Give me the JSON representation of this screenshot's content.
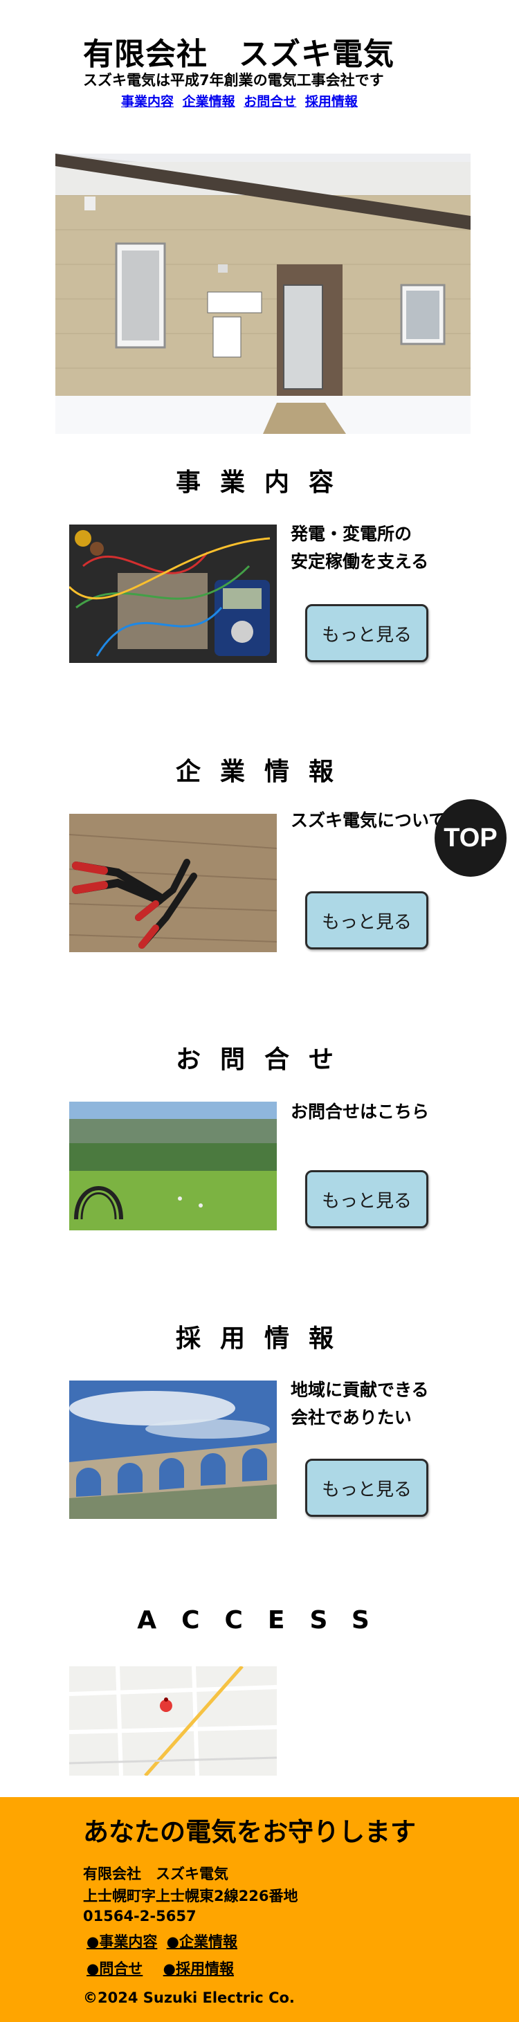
{
  "header": {
    "title": "有限会社　スズキ電気",
    "tagline": "スズキ電気は平成7年創業の電気工事会社です",
    "nav": [
      "事業内容",
      "企業情報",
      "お問合せ",
      "採用情報"
    ]
  },
  "sections": [
    {
      "title": "事業内容",
      "blurb": "発電・変電所の\n安定稼働を支える",
      "button": "もっと見る",
      "image_icon": "electronics-tester-photo"
    },
    {
      "title": "企業情報",
      "blurb": "スズキ電気について",
      "button": "もっと見る",
      "image_icon": "pliers-on-wood-photo"
    },
    {
      "title": "お問合せ",
      "blurb": "お問合せはこちら",
      "button": "もっと見る",
      "image_icon": "meadow-arch-photo"
    },
    {
      "title": "採用情報",
      "blurb": "地域に貢献できる\n会社でありたい",
      "button": "もっと見る",
      "image_icon": "arch-bridge-photo"
    }
  ],
  "access": {
    "title": "ACCESS"
  },
  "top_button": "TOP",
  "footer": {
    "slogan": "あなたの電気をお守りします",
    "company": "有限会社　スズキ電気",
    "address": "上士幌町字上士幌東2線226番地",
    "phone": "01564-2-5657",
    "links": [
      "●事業内容",
      "●企業情報",
      "●問合せ",
      "●採用情報"
    ],
    "copyright": "©2024 Suzuki Electric Co."
  },
  "colors": {
    "footer_bg": "#ffa500",
    "button_bg": "#add8e6",
    "link": "#0000ee"
  }
}
